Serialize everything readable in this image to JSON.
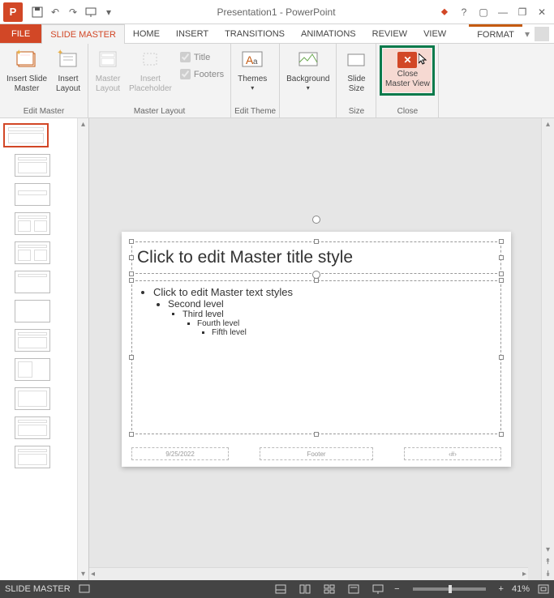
{
  "window": {
    "title": "Presentation1 - PowerPoint"
  },
  "qat": {
    "save": "💾",
    "undo": "↶",
    "redo": "↷",
    "start": "▷",
    "more": "▾"
  },
  "tabs": {
    "file": "FILE",
    "slide_master": "SLIDE MASTER",
    "home": "HOME",
    "insert": "INSERT",
    "transitions": "TRANSITIONS",
    "animations": "ANIMATIONS",
    "review": "REVIEW",
    "view": "VIEW",
    "format": "FORMAT"
  },
  "ribbon": {
    "edit_master": {
      "insert_slide_master": "Insert Slide\nMaster",
      "insert_layout": "Insert\nLayout",
      "label": "Edit Master"
    },
    "master_layout": {
      "master_layout": "Master\nLayout",
      "insert_placeholder": "Insert\nPlaceholder",
      "title_chk": "Title",
      "footers_chk": "Footers",
      "label": "Master Layout"
    },
    "edit_theme": {
      "themes": "Themes",
      "label": "Edit Theme"
    },
    "background": {
      "background": "Background",
      "label": ""
    },
    "size": {
      "slide_size": "Slide\nSize",
      "label": "Size"
    },
    "close": {
      "close_master": "Close\nMaster View",
      "label": "Close"
    }
  },
  "slide": {
    "title_placeholder": "Click to edit Master title style",
    "body_l1": "Click to edit Master text styles",
    "body_l2": "Second level",
    "body_l3": "Third level",
    "body_l4": "Fourth level",
    "body_l5": "Fifth level",
    "footer_date": "9/25/2022",
    "footer_center": "Footer",
    "footer_num": "‹#›"
  },
  "thumbs": {
    "master_index": "1"
  },
  "status": {
    "mode": "SLIDE MASTER",
    "zoom": "41%"
  }
}
